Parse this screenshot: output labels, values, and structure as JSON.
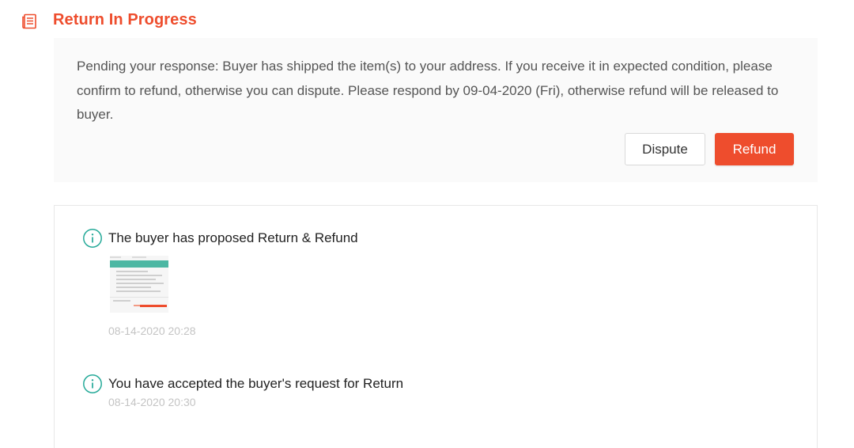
{
  "header": {
    "title": "Return In Progress",
    "icon": "document-list-icon",
    "accent_color": "#ee4d2d"
  },
  "notice": {
    "text": "Pending your response: Buyer has shipped the item(s) to your address. If you receive it in expected condition, please confirm to refund, otherwise you can dispute. Please respond by 09-04-2020 (Fri), otherwise refund will be released to buyer.",
    "buttons": {
      "dispute": "Dispute",
      "refund": "Refund"
    }
  },
  "timeline": {
    "events": [
      {
        "icon": "info-circle-icon",
        "title": "The buyer has proposed Return & Refund",
        "has_image": true,
        "time": "08-14-2020 20:28"
      },
      {
        "icon": "info-circle-icon",
        "title": "You have accepted the buyer's request for Return",
        "time": "08-14-2020 20:30"
      }
    ],
    "icon_color": "#26aa99"
  }
}
